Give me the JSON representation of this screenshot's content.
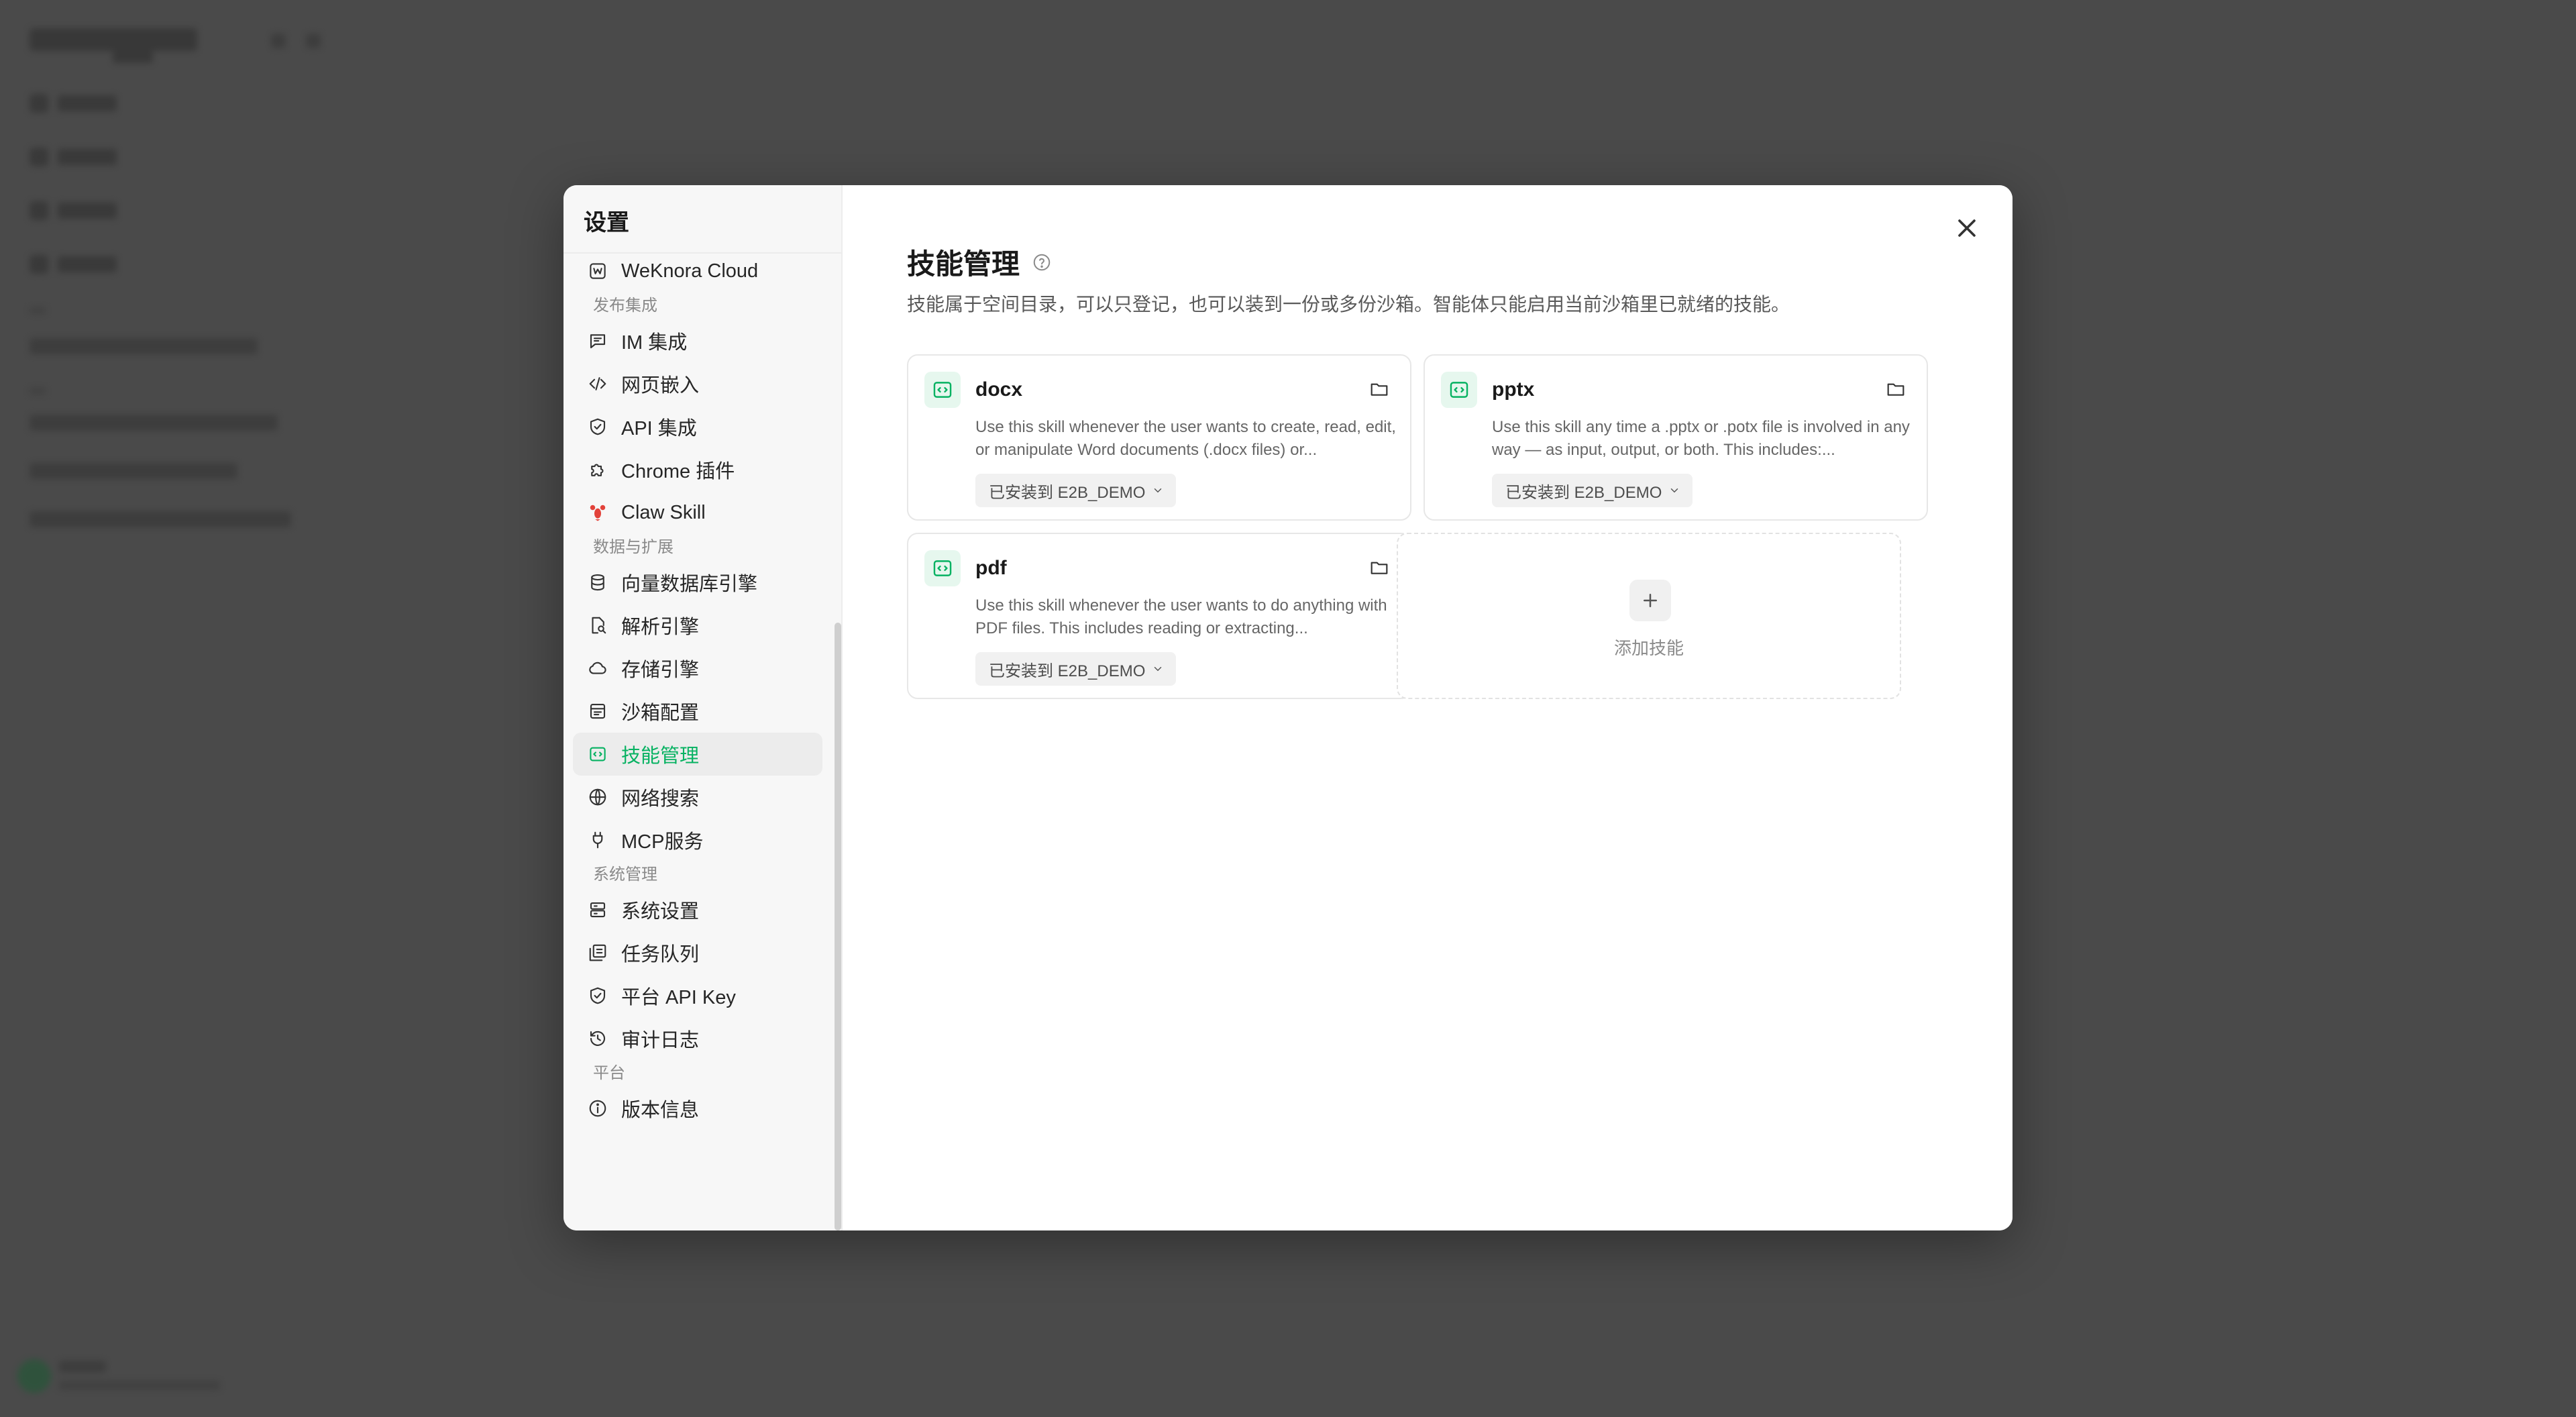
{
  "settings": {
    "title": "设置"
  },
  "sidebar": {
    "items": [
      {
        "type": "item",
        "label": "WeKnora Cloud",
        "icon": "weknora-icon"
      },
      {
        "type": "group",
        "label": "发布集成"
      },
      {
        "type": "item",
        "label": "IM 集成",
        "icon": "chat-icon"
      },
      {
        "type": "item",
        "label": "网页嵌入",
        "icon": "code-icon"
      },
      {
        "type": "item",
        "label": "API 集成",
        "icon": "shield-icon"
      },
      {
        "type": "item",
        "label": "Chrome 插件",
        "icon": "puzzle-icon"
      },
      {
        "type": "item",
        "label": "Claw Skill",
        "icon": "lobster-icon"
      },
      {
        "type": "group",
        "label": "数据与扩展"
      },
      {
        "type": "item",
        "label": "向量数据库引擎",
        "icon": "database-icon"
      },
      {
        "type": "item",
        "label": "解析引擎",
        "icon": "file-search-icon"
      },
      {
        "type": "item",
        "label": "存储引擎",
        "icon": "cloud-icon"
      },
      {
        "type": "item",
        "label": "沙箱配置",
        "icon": "sandbox-icon"
      },
      {
        "type": "item",
        "label": "技能管理",
        "icon": "skill-icon",
        "active": true
      },
      {
        "type": "item",
        "label": "网络搜索",
        "icon": "globe-icon"
      },
      {
        "type": "item",
        "label": "MCP服务",
        "icon": "plug-icon"
      },
      {
        "type": "group",
        "label": "系统管理"
      },
      {
        "type": "item",
        "label": "系统设置",
        "icon": "server-icon"
      },
      {
        "type": "item",
        "label": "任务队列",
        "icon": "queue-icon"
      },
      {
        "type": "item",
        "label": "平台 API Key",
        "icon": "shield-check-icon"
      },
      {
        "type": "item",
        "label": "审计日志",
        "icon": "history-icon"
      },
      {
        "type": "group",
        "label": "平台"
      },
      {
        "type": "item",
        "label": "版本信息",
        "icon": "info-icon"
      }
    ]
  },
  "main": {
    "title": "技能管理",
    "description": "技能属于空间目录，可以只登记，也可以装到一份或多份沙箱。智能体只能启用当前沙箱里已就绪的技能。",
    "skills": [
      {
        "name": "docx",
        "description": "Use this skill whenever the user wants to create, read, edit, or manipulate Word documents (.docx files) or...",
        "status": "已安装到 E2B_DEMO"
      },
      {
        "name": "pptx",
        "description": "Use this skill any time a .pptx or .potx file is involved in any way — as input, output, or both. This includes:...",
        "status": "已安装到 E2B_DEMO"
      },
      {
        "name": "pdf",
        "description": "Use this skill whenever the user wants to do anything with PDF files. This includes reading or extracting...",
        "status": "已安装到 E2B_DEMO"
      }
    ],
    "add_label": "添加技能"
  },
  "colors": {
    "accent": "#07b262",
    "accent_bg": "#e6f7ee"
  }
}
